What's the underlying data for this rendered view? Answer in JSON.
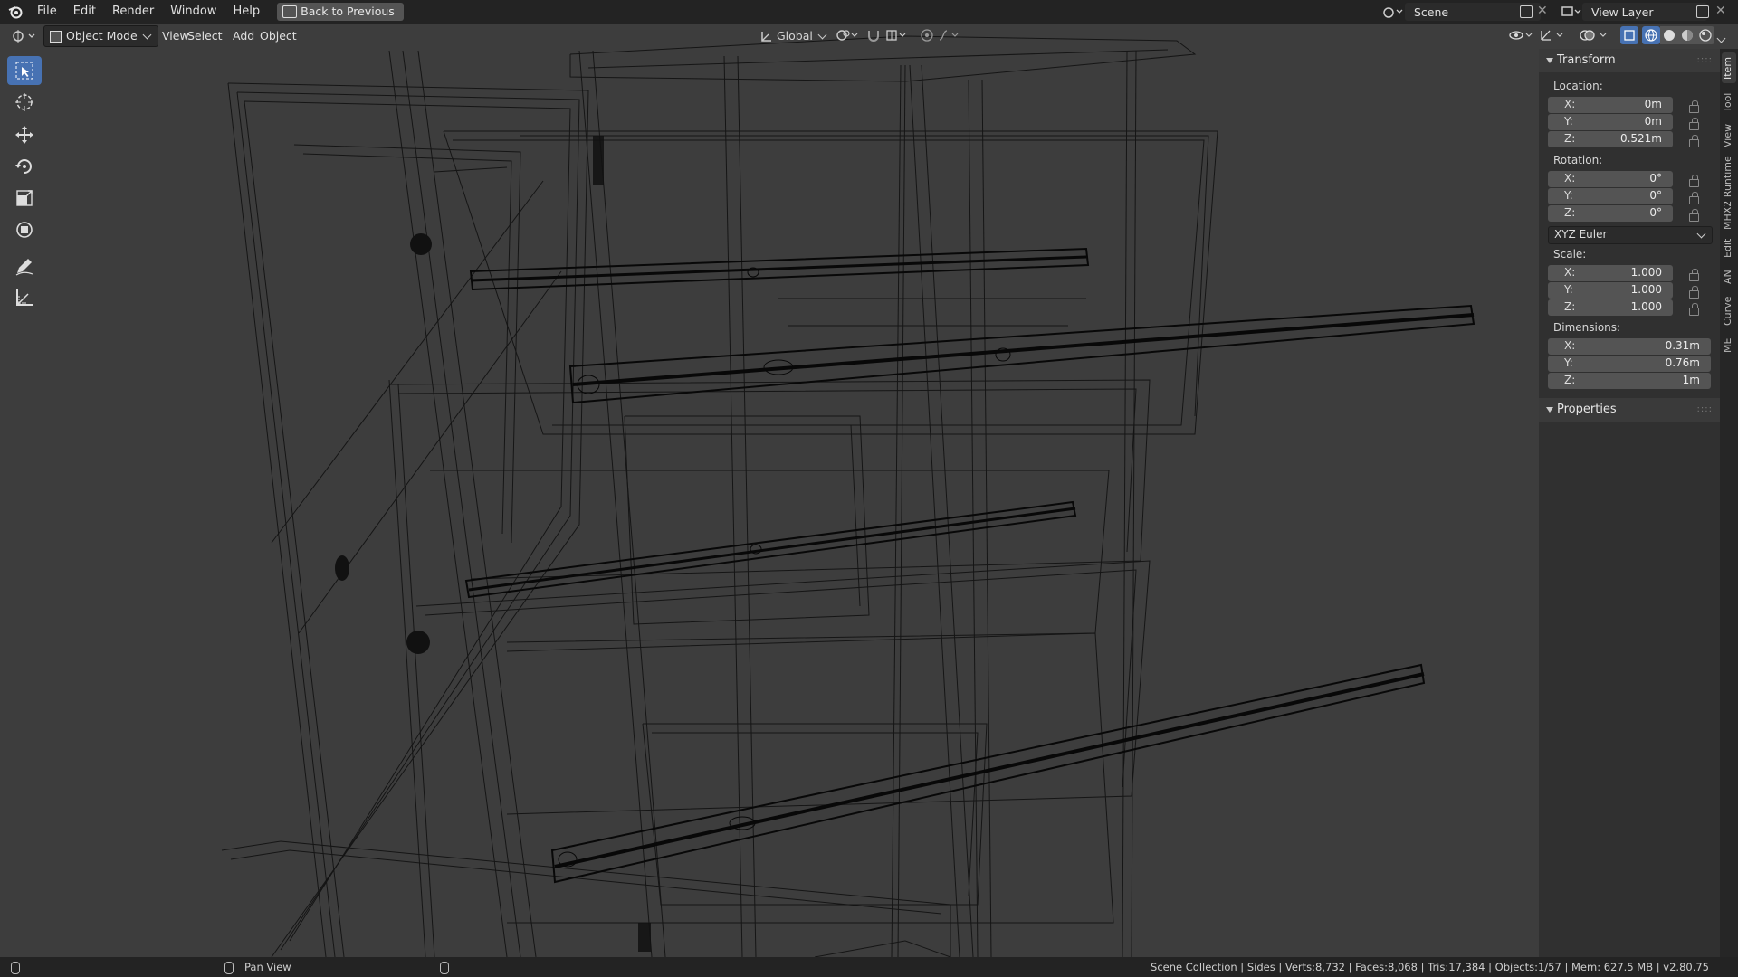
{
  "topbar": {
    "menu": [
      "File",
      "Edit",
      "Render",
      "Window",
      "Help"
    ],
    "back_button": "Back to Previous",
    "scene": "Scene",
    "view_layer": "View Layer"
  },
  "header": {
    "mode": "Object Mode",
    "menus": [
      "View",
      "Select",
      "Add",
      "Object"
    ],
    "orientation": "Global"
  },
  "toolbar": {
    "tools": [
      "select-box-icon",
      "cursor-icon",
      "move-icon",
      "rotate-icon",
      "scale-icon",
      "transform-icon",
      "annotate-icon",
      "measure-icon"
    ]
  },
  "npanel": {
    "transform_title": "Transform",
    "location_label": "Location:",
    "location": [
      {
        "axis": "X:",
        "value": "0m"
      },
      {
        "axis": "Y:",
        "value": "0m"
      },
      {
        "axis": "Z:",
        "value": "0.521m"
      }
    ],
    "rotation_label": "Rotation:",
    "rotation": [
      {
        "axis": "X:",
        "value": "0°"
      },
      {
        "axis": "Y:",
        "value": "0°"
      },
      {
        "axis": "Z:",
        "value": "0°"
      }
    ],
    "rotation_mode": "XYZ Euler",
    "scale_label": "Scale:",
    "scale": [
      {
        "axis": "X:",
        "value": "1.000"
      },
      {
        "axis": "Y:",
        "value": "1.000"
      },
      {
        "axis": "Z:",
        "value": "1.000"
      }
    ],
    "dimensions_label": "Dimensions:",
    "dimensions": [
      {
        "axis": "X:",
        "value": "0.31m"
      },
      {
        "axis": "Y:",
        "value": "0.76m"
      },
      {
        "axis": "Z:",
        "value": "1m"
      }
    ],
    "properties_title": "Properties"
  },
  "tabs": [
    "Item",
    "Tool",
    "View",
    "MHX2 Runtime",
    "Edit",
    "AN",
    "Curve",
    "ME"
  ],
  "status": {
    "pan_view": "Pan View",
    "stats": "Scene Collection | Sides | Verts:8,732 | Faces:8,068 | Tris:17,384 | Objects:1/57 | Mem: 627.5 MB | v2.80.75"
  },
  "colors": {
    "accent": "#4772b3",
    "viewport": "#3d3d3d",
    "wire": "#0c0c0c"
  }
}
